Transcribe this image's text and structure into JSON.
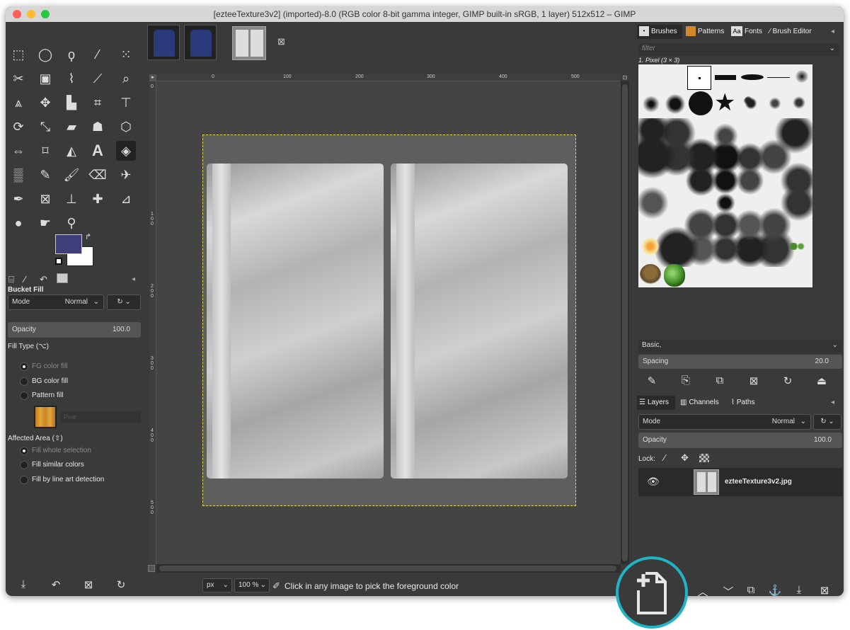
{
  "window": {
    "title": "[ezteeTexture3v2] (imported)-8.0 (RGB color 8-bit gamma integer, GIMP built-in sRGB, 1 layer) 512x512 – GIMP"
  },
  "colors": {
    "fg": "#3f3e7a",
    "bg": "#ffffff",
    "selection": "#e6d54c",
    "highlight_ring": "#1fb5c4"
  },
  "tool_options": {
    "title": "Bucket Fill",
    "mode_label": "Mode",
    "mode_value": "Normal",
    "opacity_label": "Opacity",
    "opacity_value": "100.0",
    "fill_type_label": "Fill Type  (⌥)",
    "fill_types": [
      "FG color fill",
      "BG color fill",
      "Pattern fill"
    ],
    "pattern_name": "Pine",
    "affected_area_label": "Affected Area  (⇧)",
    "affected_areas": [
      "Fill whole selection",
      "Fill similar colors",
      "Fill by line art detection"
    ]
  },
  "ruler": {
    "h": [
      "0",
      "100",
      "200",
      "300",
      "400",
      "500"
    ],
    "v": [
      "0",
      "1 0 0",
      "2 0 0",
      "3 0 0",
      "4 0 0",
      "5 0 0"
    ]
  },
  "status": {
    "unit": "px",
    "zoom": "100 %",
    "message": "Click in any image to pick the foreground color"
  },
  "brushes_dock": {
    "tabs": [
      "Brushes",
      "Patterns",
      "Fonts",
      "Brush Editor"
    ],
    "filter_placeholder": "filter",
    "selected": "1. Pixel (3 × 3)",
    "preset": "Basic,",
    "spacing_label": "Spacing",
    "spacing_value": "20.0"
  },
  "layers_dock": {
    "tabs": [
      "Layers",
      "Channels",
      "Paths"
    ],
    "mode_label": "Mode",
    "mode_value": "Normal",
    "opacity_label": "Opacity",
    "opacity_value": "100.0",
    "lock_label": "Lock:",
    "layer_name": "ezteeTexture3v2.jpg"
  }
}
